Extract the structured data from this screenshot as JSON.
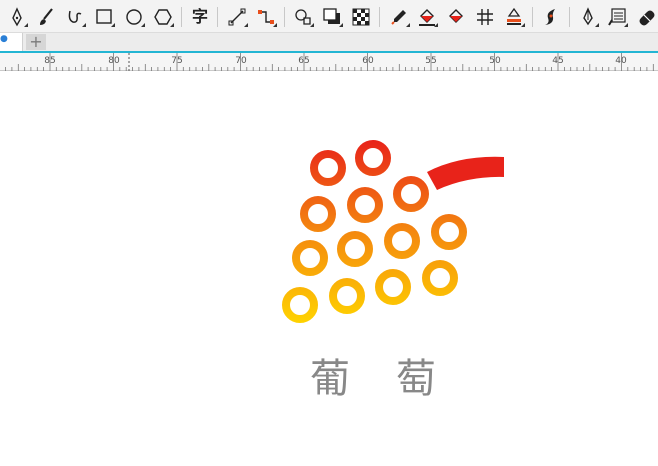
{
  "toolbar": {
    "tools": [
      {
        "icon": "pen-nib-icon"
      },
      {
        "icon": "brush-icon"
      },
      {
        "icon": "curve-hook-icon"
      },
      {
        "icon": "rectangle-icon"
      },
      {
        "icon": "ellipse-icon"
      },
      {
        "icon": "polygon-icon"
      },
      {
        "icon": "text-tool-icon",
        "label": "字"
      },
      {
        "icon": "line-connector-icon"
      },
      {
        "icon": "elbow-connector-icon"
      },
      {
        "icon": "blend-shapes-icon"
      },
      {
        "icon": "drop-shadow-icon"
      },
      {
        "icon": "transparency-checker-icon"
      },
      {
        "icon": "eyedropper-icon"
      },
      {
        "icon": "fill-bucket-icon"
      },
      {
        "icon": "smart-fill-icon"
      },
      {
        "icon": "mesh-fill-icon"
      },
      {
        "icon": "outline-fill-icon"
      },
      {
        "icon": "calligraphy-pen-icon"
      },
      {
        "icon": "fountain-pen-icon"
      },
      {
        "icon": "attributes-eyedropper-icon"
      },
      {
        "icon": "capsule-icon"
      }
    ]
  },
  "tabs": {
    "add_label": "+"
  },
  "ruler": {
    "labels": [
      "85",
      "80",
      "75",
      "70",
      "65",
      "60",
      "55",
      "50",
      "45",
      "40"
    ]
  },
  "logo": {
    "char1": "葡",
    "char2": "萄",
    "gradient_top": "#e8231a",
    "gradient_bottom": "#ffd400"
  }
}
